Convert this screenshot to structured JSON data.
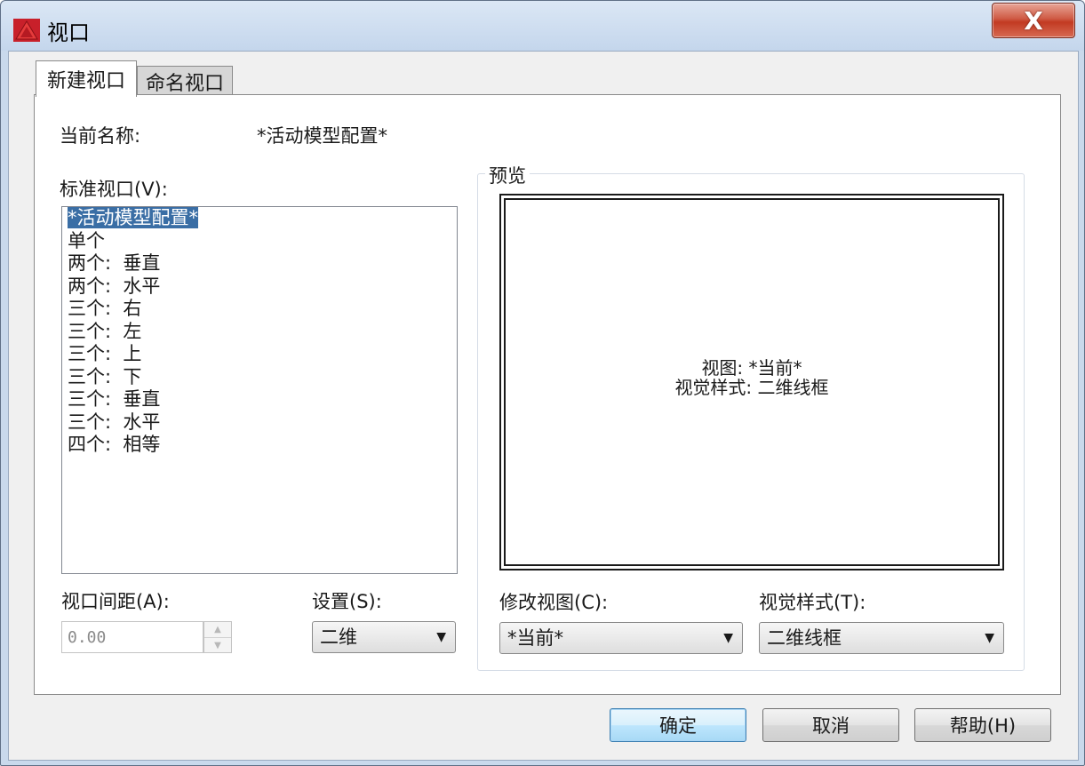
{
  "window": {
    "title": "视口",
    "close_label": "X"
  },
  "tabs": [
    {
      "label": "新建视口",
      "active": true
    },
    {
      "label": "命名视口",
      "active": false
    }
  ],
  "current_name": {
    "label": "当前名称:",
    "value": "*活动模型配置*"
  },
  "standard_viewports": {
    "label": "标准视口(V):",
    "items": [
      "*活动模型配置*",
      "单个",
      "两个:  垂直",
      "两个:  水平",
      "三个:  右",
      "三个:  左",
      "三个:  上",
      "三个:  下",
      "三个:  垂直",
      "三个:  水平",
      "四个:  相等"
    ],
    "selected_index": 0
  },
  "preview": {
    "title": "预览",
    "view_line": "视图: *当前*",
    "style_line": "视觉样式: 二维线框"
  },
  "viewport_spacing": {
    "label": "视口间距(A):",
    "value": "0.00"
  },
  "setup": {
    "label": "设置(S):",
    "value": "二维"
  },
  "change_view": {
    "label": "修改视图(C):",
    "value": "*当前*"
  },
  "visual_style": {
    "label": "视觉样式(T):",
    "value": "二维线框"
  },
  "buttons": {
    "ok": "确定",
    "cancel": "取消",
    "help": "帮助(H)"
  },
  "colors": {
    "selection": "#3a6ea5",
    "close_button": "#c23a22",
    "titlebar": "#c4d6ec"
  },
  "icons": {
    "app": "autocad-logo-icon",
    "dropdown": "dropdown-arrow-icon"
  }
}
